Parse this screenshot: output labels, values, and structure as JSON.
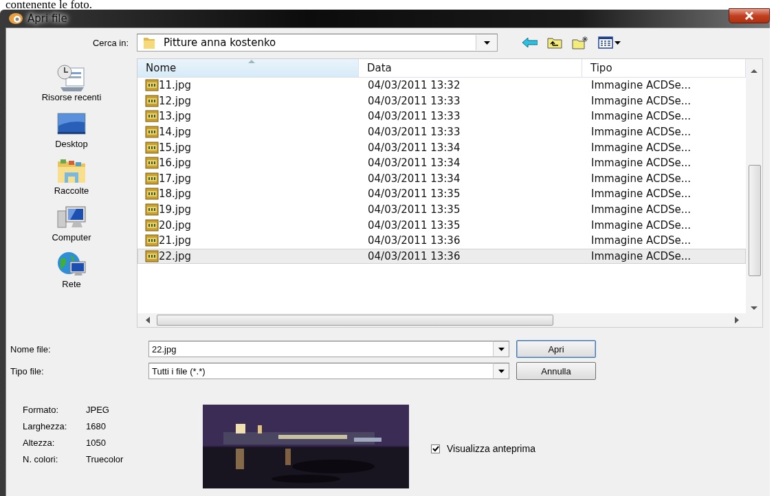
{
  "caption": "contenente le foto.",
  "window": {
    "title": "Apri file"
  },
  "look_in": {
    "label": "Cerca in:",
    "value": "Pitture anna kostenko"
  },
  "places": [
    {
      "label": "Risorse recenti",
      "kind": "recent"
    },
    {
      "label": "Desktop",
      "kind": "desktop"
    },
    {
      "label": "Raccolte",
      "kind": "libraries"
    },
    {
      "label": "Computer",
      "kind": "computer"
    },
    {
      "label": "Rete",
      "kind": "network"
    }
  ],
  "table": {
    "columns": [
      {
        "label": "Nome",
        "sorted": true
      },
      {
        "label": "Data",
        "sorted": false
      },
      {
        "label": "Tipo",
        "sorted": false
      }
    ],
    "rows": [
      {
        "name": "11.jpg",
        "date": "04/03/2011 13:32",
        "type": "Immagine ACDSe...",
        "selected": false
      },
      {
        "name": "12.jpg",
        "date": "04/03/2011 13:33",
        "type": "Immagine ACDSe...",
        "selected": false
      },
      {
        "name": "13.jpg",
        "date": "04/03/2011 13:33",
        "type": "Immagine ACDSe...",
        "selected": false
      },
      {
        "name": "14.jpg",
        "date": "04/03/2011 13:33",
        "type": "Immagine ACDSe...",
        "selected": false
      },
      {
        "name": "15.jpg",
        "date": "04/03/2011 13:34",
        "type": "Immagine ACDSe...",
        "selected": false
      },
      {
        "name": "16.jpg",
        "date": "04/03/2011 13:34",
        "type": "Immagine ACDSe...",
        "selected": false
      },
      {
        "name": "17.jpg",
        "date": "04/03/2011 13:34",
        "type": "Immagine ACDSe...",
        "selected": false
      },
      {
        "name": "18.jpg",
        "date": "04/03/2011 13:35",
        "type": "Immagine ACDSe...",
        "selected": false
      },
      {
        "name": "19.jpg",
        "date": "04/03/2011 13:35",
        "type": "Immagine ACDSe...",
        "selected": false
      },
      {
        "name": "20.jpg",
        "date": "04/03/2011 13:35",
        "type": "Immagine ACDSe...",
        "selected": false
      },
      {
        "name": "21.jpg",
        "date": "04/03/2011 13:36",
        "type": "Immagine ACDSe...",
        "selected": false
      },
      {
        "name": "22.jpg",
        "date": "04/03/2011 13:36",
        "type": "Immagine ACDSe...",
        "selected": true
      }
    ]
  },
  "file_name": {
    "label": "Nome file:",
    "value": "22.jpg"
  },
  "file_type": {
    "label": "Tipo file:",
    "value": "Tutti i file (*.*)"
  },
  "buttons": [
    {
      "label": "Apri",
      "kind": "default"
    },
    {
      "label": "Annulla",
      "kind": "normal"
    }
  ],
  "info": [
    {
      "label": "Formato:",
      "value": "JPEG"
    },
    {
      "label": "Larghezza:",
      "value": "1680"
    },
    {
      "label": "Altezza:",
      "value": "1050"
    },
    {
      "label": "N. colori:",
      "value": "Truecolor"
    }
  ],
  "show_preview": {
    "label": "Visualizza anteprima",
    "checked": true
  }
}
